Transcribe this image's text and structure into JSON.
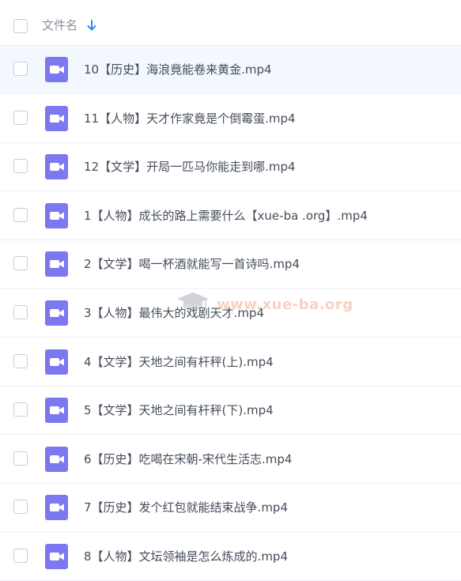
{
  "header": {
    "column_label": "文件名",
    "sort_icon": "arrow-down-icon"
  },
  "files": [
    {
      "name": "10【历史】海浪竟能卷来黄金.mp4",
      "icon": "video-file-icon",
      "highlighted": true
    },
    {
      "name": "11【人物】天才作家竟是个倒霉蛋.mp4",
      "icon": "video-file-icon"
    },
    {
      "name": "12【文学】开局一匹马你能走到哪.mp4",
      "icon": "video-file-icon"
    },
    {
      "name": "1【人物】成长的路上需要什么【xue-ba .org】.mp4",
      "icon": "video-file-icon"
    },
    {
      "name": "2【文学】喝一杯酒就能写一首诗吗.mp4",
      "icon": "video-file-icon"
    },
    {
      "name": "3【人物】最伟大的戏剧天才.mp4",
      "icon": "video-file-icon"
    },
    {
      "name": "4【文学】天地之间有杆秤(上).mp4",
      "icon": "video-file-icon"
    },
    {
      "name": "5【文学】天地之间有杆秤(下).mp4",
      "icon": "video-file-icon"
    },
    {
      "name": "6【历史】吃喝在宋朝-宋代生活志.mp4",
      "icon": "video-file-icon"
    },
    {
      "name": "7【历史】发个红包就能结束战争.mp4",
      "icon": "video-file-icon"
    },
    {
      "name": "8【人物】文坛领袖是怎么炼成的.mp4",
      "icon": "video-file-icon"
    }
  ],
  "watermark": {
    "text": "www.xue-ba.org",
    "icon": "graduation-cap-icon"
  },
  "colors": {
    "accent": "#2a8cf0",
    "video_icon": "#7b78f0",
    "highlight_row": "#f3f8ff",
    "text": "#454d5a",
    "muted_text": "#8a8f99",
    "divider": "#eef0f4"
  }
}
